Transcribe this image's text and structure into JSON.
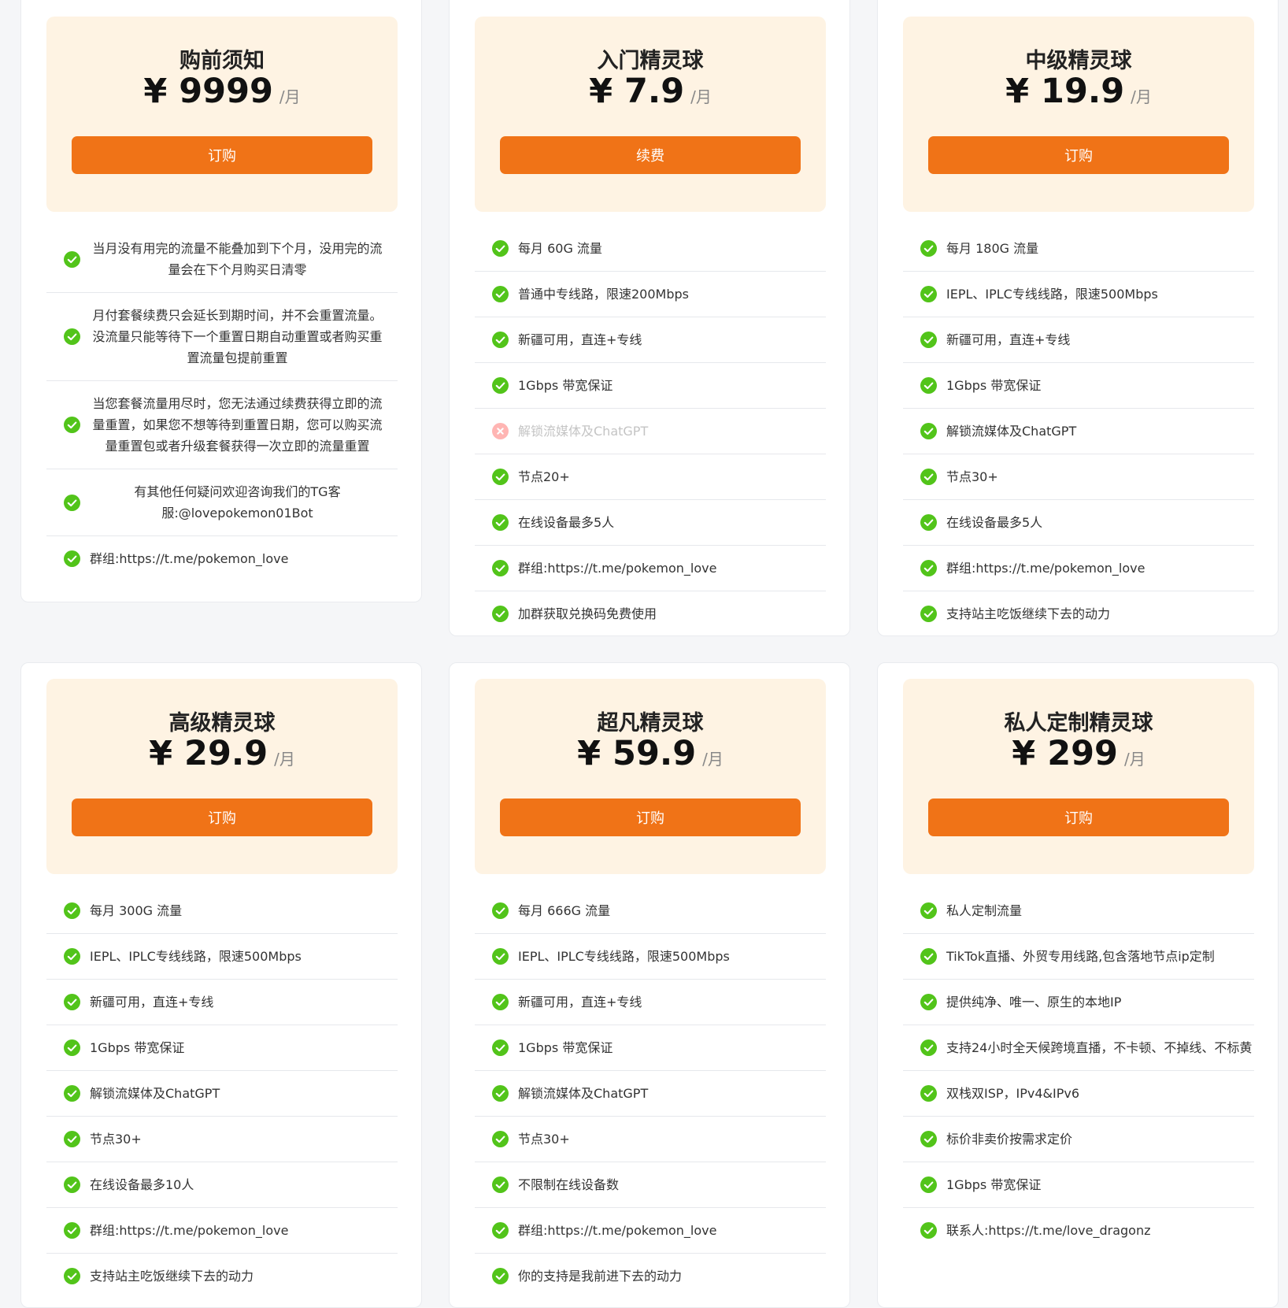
{
  "currency": "¥",
  "colors": {
    "accent": "#f07317",
    "header_bg": "#fef3e3",
    "check": "#52c41a",
    "cross": "#ff7875"
  },
  "plans": [
    {
      "title": "购前须知",
      "price": "9999",
      "unit": "/月",
      "button": "订购",
      "features": [
        {
          "text": "当月没有用完的流量不能叠加到下个月，没用完的流量会在下个月购买日清零",
          "ok": true
        },
        {
          "text": "月付套餐续费只会延长到期时间，并不会重置流量。没流量只能等待下一个重置日期自动重置或者购买重置流量包提前重置",
          "ok": true
        },
        {
          "text": "当您套餐流量用尽时，您无法通过续费获得立即的流量重置，如果您不想等待到重置日期，您可以购买流量重置包或者升级套餐获得一次立即的流量重置",
          "ok": true
        },
        {
          "text": "有其他任何疑问欢迎咨询我们的TG客服:@lovepokemon01Bot",
          "ok": true
        },
        {
          "text": "群组:https://t.me/pokemon_love",
          "ok": true
        }
      ]
    },
    {
      "title": "入门精灵球",
      "price": "7.9",
      "unit": "/月",
      "button": "续费",
      "features": [
        {
          "text": "每月 60G 流量",
          "ok": true
        },
        {
          "text": "普通中专线路，限速200Mbps",
          "ok": true
        },
        {
          "text": "新疆可用，直连+专线",
          "ok": true
        },
        {
          "text": "1Gbps 带宽保证",
          "ok": true
        },
        {
          "text": "解锁流媒体及ChatGPT",
          "ok": false
        },
        {
          "text": "节点20+",
          "ok": true
        },
        {
          "text": "在线设备最多5人",
          "ok": true
        },
        {
          "text": "群组:https://t.me/pokemon_love",
          "ok": true
        },
        {
          "text": "加群获取兑换码免费使用",
          "ok": true
        }
      ]
    },
    {
      "title": "中级精灵球",
      "price": "19.9",
      "unit": "/月",
      "button": "订购",
      "features": [
        {
          "text": "每月 180G 流量",
          "ok": true
        },
        {
          "text": "IEPL、IPLC专线线路，限速500Mbps",
          "ok": true
        },
        {
          "text": "新疆可用，直连+专线",
          "ok": true
        },
        {
          "text": "1Gbps 带宽保证",
          "ok": true
        },
        {
          "text": "解锁流媒体及ChatGPT",
          "ok": true
        },
        {
          "text": "节点30+",
          "ok": true
        },
        {
          "text": "在线设备最多5人",
          "ok": true
        },
        {
          "text": "群组:https://t.me/pokemon_love",
          "ok": true
        },
        {
          "text": "支持站主吃饭继续下去的动力",
          "ok": true
        }
      ]
    },
    {
      "title": "高级精灵球",
      "price": "29.9",
      "unit": "/月",
      "button": "订购",
      "features": [
        {
          "text": "每月 300G 流量",
          "ok": true
        },
        {
          "text": "IEPL、IPLC专线线路，限速500Mbps",
          "ok": true
        },
        {
          "text": "新疆可用，直连+专线",
          "ok": true
        },
        {
          "text": "1Gbps 带宽保证",
          "ok": true
        },
        {
          "text": "解锁流媒体及ChatGPT",
          "ok": true
        },
        {
          "text": "节点30+",
          "ok": true
        },
        {
          "text": "在线设备最多10人",
          "ok": true
        },
        {
          "text": "群组:https://t.me/pokemon_love",
          "ok": true
        },
        {
          "text": "支持站主吃饭继续下去的动力",
          "ok": true
        }
      ]
    },
    {
      "title": "超凡精灵球",
      "price": "59.9",
      "unit": "/月",
      "button": "订购",
      "features": [
        {
          "text": "每月 666G 流量",
          "ok": true
        },
        {
          "text": "IEPL、IPLC专线线路，限速500Mbps",
          "ok": true
        },
        {
          "text": "新疆可用，直连+专线",
          "ok": true
        },
        {
          "text": "1Gbps 带宽保证",
          "ok": true
        },
        {
          "text": "解锁流媒体及ChatGPT",
          "ok": true
        },
        {
          "text": "节点30+",
          "ok": true
        },
        {
          "text": "不限制在线设备数",
          "ok": true
        },
        {
          "text": "群组:https://t.me/pokemon_love",
          "ok": true
        },
        {
          "text": "你的支持是我前进下去的动力",
          "ok": true
        }
      ]
    },
    {
      "title": "私人定制精灵球",
      "price": "299",
      "unit": "/月",
      "button": "订购",
      "features": [
        {
          "text": "私人定制流量",
          "ok": true
        },
        {
          "text": "TikTok直播、外贸专用线路,包含落地节点ip定制",
          "ok": true
        },
        {
          "text": "提供纯净、唯一、原生的本地IP",
          "ok": true
        },
        {
          "text": "支持24小时全天候跨境直播，不卡顿、不掉线、不标黄",
          "ok": true
        },
        {
          "text": "双栈双ISP，IPv4&IPv6",
          "ok": true
        },
        {
          "text": "标价非卖价按需求定价",
          "ok": true
        },
        {
          "text": "1Gbps 带宽保证",
          "ok": true
        },
        {
          "text": "联系人:https://t.me/love_dragonz",
          "ok": true
        }
      ]
    }
  ]
}
